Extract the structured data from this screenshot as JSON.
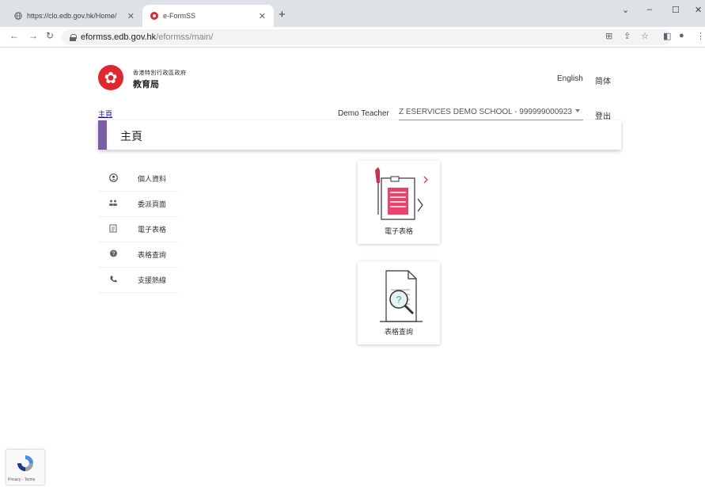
{
  "browser": {
    "tabs": [
      {
        "title": "https://clo.edb.gov.hk/Home/",
        "active": false
      },
      {
        "title": "e-FormSS",
        "active": true
      }
    ],
    "new_tab": "+",
    "url_host": "eformss.edb.gov.hk",
    "url_path": "/eformss/main/"
  },
  "header": {
    "org_line1": "香港特別行政區政府",
    "org_line2": "教育局",
    "lang_english": "English",
    "lang_simplified": "简体"
  },
  "userbar": {
    "breadcrumb": "主頁",
    "user_name": "Demo Teacher",
    "school": "Z ESERVICES DEMO SCHOOL - 999999000923",
    "logout": "登出"
  },
  "page": {
    "title": "主頁",
    "accent_color": "#7b5fa6"
  },
  "sidebar": {
    "items": [
      {
        "label": "個人資料",
        "icon": "account-circle-icon"
      },
      {
        "label": "委派頁面",
        "icon": "people-icon"
      },
      {
        "label": "電子表格",
        "icon": "form-icon"
      },
      {
        "label": "表格查詢",
        "icon": "help-icon"
      },
      {
        "label": "支援熱線",
        "icon": "phone-icon"
      }
    ]
  },
  "tiles": [
    {
      "label": "電子表格",
      "icon": "eform-document-icon"
    },
    {
      "label": "表格查詢",
      "icon": "form-search-icon"
    }
  ],
  "recaptcha": {
    "terms": "Privacy - Terms"
  }
}
